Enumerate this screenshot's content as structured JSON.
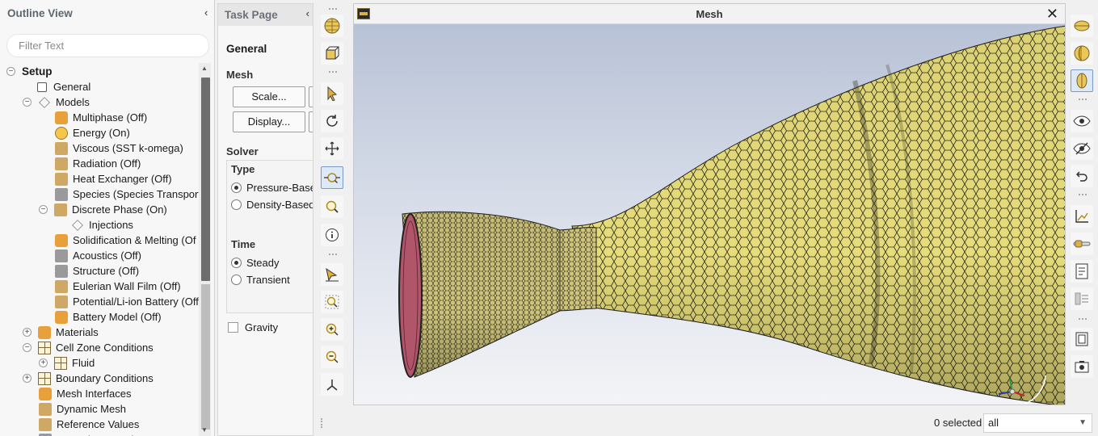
{
  "outline": {
    "title": "Outline View",
    "collapse_glyph": "‹",
    "filter_placeholder": "Filter Text",
    "items": [
      {
        "label": "Setup",
        "icon": "setup-toggle",
        "toggle": "−"
      },
      {
        "label": "General",
        "icon": "general-icon"
      },
      {
        "label": "Models",
        "icon": "models-icon",
        "toggle": "−"
      },
      {
        "label": "Multiphase (Off)",
        "icon": "multiphase-icon"
      },
      {
        "label": "Energy (On)",
        "icon": "energy-icon"
      },
      {
        "label": "Viscous (SST k-omega)",
        "icon": "viscous-icon"
      },
      {
        "label": "Radiation (Off)",
        "icon": "radiation-icon"
      },
      {
        "label": "Heat Exchanger (Off)",
        "icon": "heat-exchanger-icon"
      },
      {
        "label": "Species (Species Transport",
        "icon": "species-icon"
      },
      {
        "label": "Discrete Phase (On)",
        "icon": "discrete-phase-icon",
        "toggle": "−"
      },
      {
        "label": "Injections",
        "icon": "injections-icon"
      },
      {
        "label": "Solidification & Melting (Of",
        "icon": "solidification-icon"
      },
      {
        "label": "Acoustics (Off)",
        "icon": "acoustics-icon"
      },
      {
        "label": "Structure (Off)",
        "icon": "structure-icon"
      },
      {
        "label": "Eulerian Wall Film (Off)",
        "icon": "eulerian-wall-film-icon"
      },
      {
        "label": "Potential/Li-ion Battery (Off",
        "icon": "battery-potential-icon"
      },
      {
        "label": "Battery Model (Off)",
        "icon": "battery-model-icon"
      },
      {
        "label": "Materials",
        "icon": "materials-icon",
        "toggle": "+"
      },
      {
        "label": "Cell Zone Conditions",
        "icon": "cell-zone-icon",
        "toggle": "−"
      },
      {
        "label": "Fluid",
        "icon": "fluid-icon",
        "toggle": "+"
      },
      {
        "label": "Boundary Conditions",
        "icon": "boundary-conditions-icon",
        "toggle": "+"
      },
      {
        "label": "Mesh Interfaces",
        "icon": "mesh-interfaces-icon"
      },
      {
        "label": "Dynamic Mesh",
        "icon": "dynamic-mesh-icon"
      },
      {
        "label": "Reference Values",
        "icon": "reference-values-icon"
      },
      {
        "label": "Named Expressions",
        "icon": "named-expressions-icon"
      }
    ]
  },
  "task": {
    "title": "Task Page",
    "collapse_glyph": "‹",
    "general": "General",
    "mesh_label": "Mesh",
    "scale_button": "Scale...",
    "display_button": "Display...",
    "solver_label": "Solver",
    "type_label": "Type",
    "pressure_based": "Pressure-Based",
    "density_based": "Density-Based",
    "time_label": "Time",
    "steady": "Steady",
    "transient": "Transient",
    "gravity": "Gravity"
  },
  "graphics": {
    "title": "Mesh",
    "close_glyph": "✕"
  },
  "status": {
    "selected_count": "0 selected",
    "filter_value": "all",
    "caret": "▼"
  },
  "colors": {
    "mesh_fill": "#e6dc7a",
    "mesh_line": "#2a2a20",
    "inlet_face": "#b0556a",
    "background_top": "#b8c2d6",
    "background_bottom": "#f3f4f7"
  },
  "toolbar_left_icons": [
    "sphere-icon",
    "box-icon",
    "pointer-icon",
    "rotate-icon",
    "pan-icon",
    "zoom-box-icon",
    "zoom-icon",
    "info-icon",
    "probe-icon",
    "zoom-fit-icon",
    "zoom-in-icon",
    "zoom-out-icon",
    "axes-icon"
  ],
  "toolbar_right_icons": [
    "view-top-icon",
    "view-side-icon",
    "view-front-icon",
    "show-icon",
    "hide-icon",
    "undo-view-icon",
    "axes-plot-icon",
    "slider-icon",
    "report-icon",
    "layers-icon",
    "window-icon",
    "camera-icon"
  ]
}
